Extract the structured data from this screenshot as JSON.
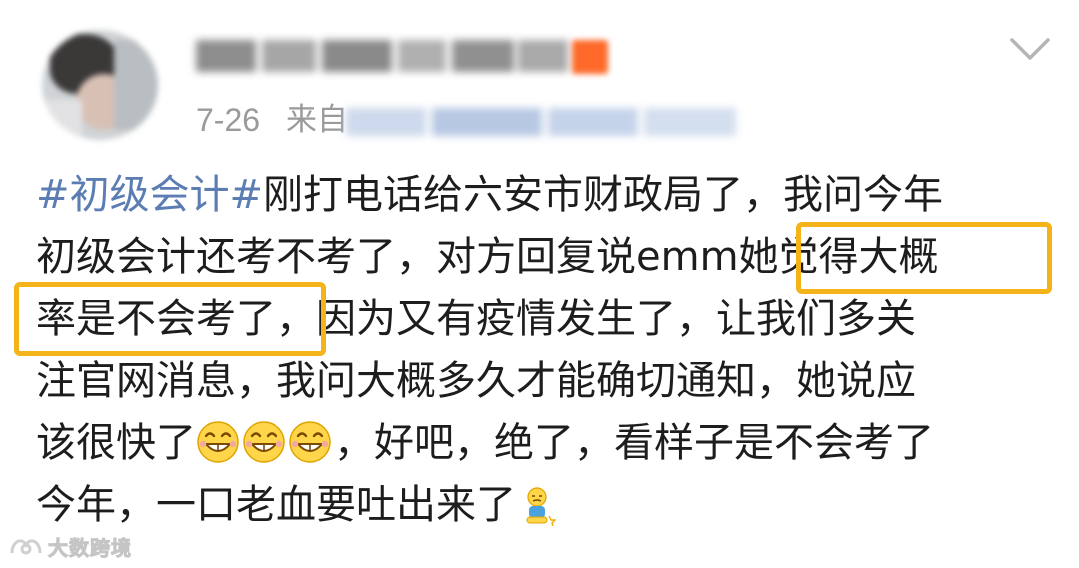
{
  "header": {
    "date": "7-26",
    "from_label": "来自"
  },
  "post": {
    "lines": [
      {
        "parts": [
          {
            "text": "#初级会计#",
            "type": "hashtag"
          },
          {
            "text": "刚打电话给六安市财政局了，我问今年",
            "type": "text"
          }
        ]
      },
      {
        "parts": [
          {
            "text": "初级会计还考不考了，对方回复说emm她觉得大概",
            "type": "text"
          }
        ]
      },
      {
        "parts": [
          {
            "text": "率是不会考了，因为又有疫情发生了，让我们多关",
            "type": "text"
          }
        ]
      },
      {
        "parts": [
          {
            "text": "注官网消息，我问大概多久才能确切通知，她说应",
            "type": "text"
          }
        ]
      },
      {
        "parts": [
          {
            "text": "该很快了",
            "type": "text"
          },
          {
            "icon": "grin-laughing-emoji",
            "type": "emoji"
          },
          {
            "icon": "grin-laughing-emoji",
            "type": "emoji"
          },
          {
            "icon": "grin-laughing-emoji",
            "type": "emoji"
          },
          {
            "text": "，好吧，绝了，看样子是不会考了",
            "type": "text"
          }
        ]
      },
      {
        "parts": [
          {
            "text": "今年，一口老血要吐出来了",
            "type": "text"
          },
          {
            "icon": "sitting-sad-emoji",
            "type": "emoji-small"
          }
        ]
      }
    ],
    "highlights": [
      "她觉得大概",
      "率是不会考了"
    ]
  },
  "watermark": {
    "text": "大数跨境"
  },
  "colors": {
    "hashtag": "#5b7db3",
    "highlight_border": "#f5b31a",
    "meta_text": "#9a9a9a",
    "body_text": "#1d1d1d"
  }
}
